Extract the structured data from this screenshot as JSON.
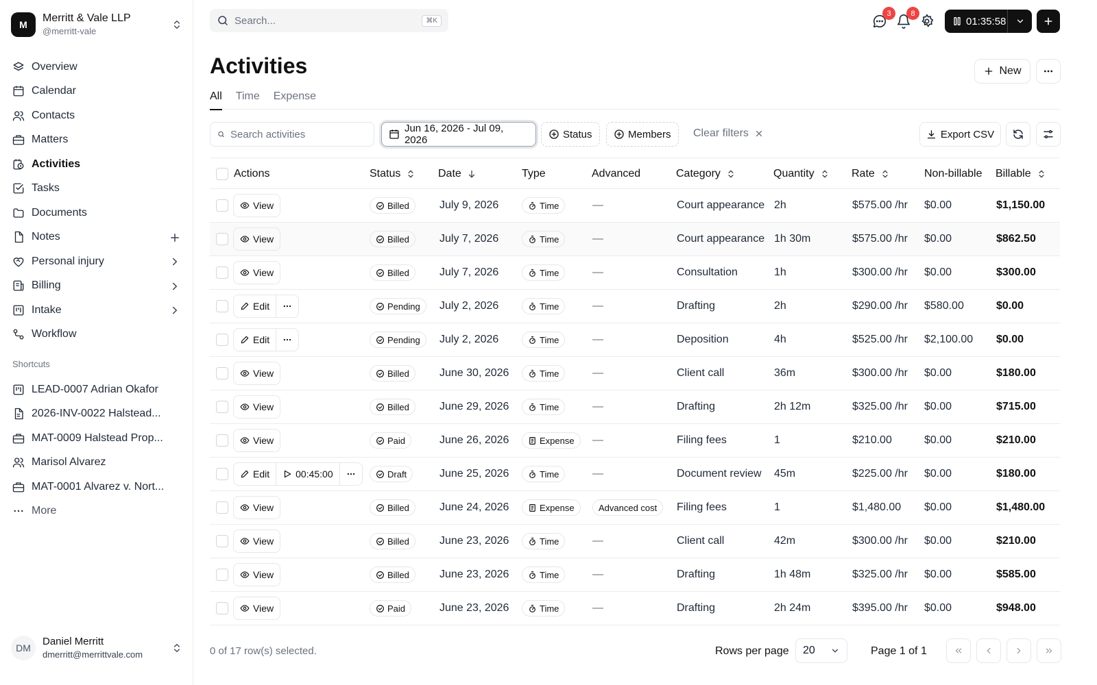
{
  "org": {
    "initial": "M",
    "name": "Merritt & Vale LLP",
    "handle": "@merritt-vale"
  },
  "nav": {
    "overview": "Overview",
    "calendar": "Calendar",
    "contacts": "Contacts",
    "matters": "Matters",
    "activities": "Activities",
    "tasks": "Tasks",
    "documents": "Documents",
    "notes": "Notes",
    "personal_injury": "Personal injury",
    "billing": "Billing",
    "intake": "Intake",
    "workflow": "Workflow"
  },
  "shortcuts": {
    "title": "Shortcuts",
    "items": [
      "LEAD-0007 Adrian Okafor",
      "2026-INV-0022 Halstead...",
      "MAT-0009 Halstead Prop...",
      "Marisol Alvarez",
      "MAT-0001 Alvarez v. Nort..."
    ],
    "more": "More"
  },
  "user": {
    "initials": "DM",
    "name": "Daniel Merritt",
    "email": "dmerritt@merrittvale.com"
  },
  "topbar": {
    "search_placeholder": "Search...",
    "search_shortcut": "⌘K",
    "messages_badge": "3",
    "notifications_badge": "8",
    "timer": "01:35:58"
  },
  "page": {
    "title": "Activities",
    "new_label": "New",
    "tabs": [
      "All",
      "Time",
      "Expense"
    ]
  },
  "filters": {
    "search_placeholder": "Search activities",
    "date_range": "Jun 16, 2026 - Jul 09, 2026",
    "status": "Status",
    "members": "Members",
    "clear": "Clear filters",
    "export": "Export CSV"
  },
  "table": {
    "headers": {
      "actions": "Actions",
      "status": "Status",
      "date": "Date",
      "type": "Type",
      "advanced": "Advanced",
      "category": "Category",
      "quantity": "Quantity",
      "rate": "Rate",
      "nonbillable": "Non-billable",
      "billable": "Billable"
    },
    "rows": [
      {
        "action": "View",
        "status": "Billed",
        "date": "July 9, 2026",
        "type": "Time",
        "advanced": "—",
        "category": "Court appearance",
        "quantity": "2h",
        "rate": "$575.00 /hr",
        "nonbillable": "$0.00",
        "billable": "$1,150.00"
      },
      {
        "action": "View",
        "status": "Billed",
        "date": "July 7, 2026",
        "type": "Time",
        "advanced": "—",
        "category": "Court appearance",
        "quantity": "1h 30m",
        "rate": "$575.00 /hr",
        "nonbillable": "$0.00",
        "billable": "$862.50"
      },
      {
        "action": "View",
        "status": "Billed",
        "date": "July 7, 2026",
        "type": "Time",
        "advanced": "—",
        "category": "Consultation",
        "quantity": "1h",
        "rate": "$300.00 /hr",
        "nonbillable": "$0.00",
        "billable": "$300.00"
      },
      {
        "action": "Edit",
        "status": "Pending",
        "date": "July 2, 2026",
        "type": "Time",
        "advanced": "—",
        "category": "Drafting",
        "quantity": "2h",
        "rate": "$290.00 /hr",
        "nonbillable": "$580.00",
        "billable": "$0.00"
      },
      {
        "action": "Edit",
        "status": "Pending",
        "date": "July 2, 2026",
        "type": "Time",
        "advanced": "—",
        "category": "Deposition",
        "quantity": "4h",
        "rate": "$525.00 /hr",
        "nonbillable": "$2,100.00",
        "billable": "$0.00"
      },
      {
        "action": "View",
        "status": "Billed",
        "date": "June 30, 2026",
        "type": "Time",
        "advanced": "—",
        "category": "Client call",
        "quantity": "36m",
        "rate": "$300.00 /hr",
        "nonbillable": "$0.00",
        "billable": "$180.00"
      },
      {
        "action": "View",
        "status": "Billed",
        "date": "June 29, 2026",
        "type": "Time",
        "advanced": "—",
        "category": "Drafting",
        "quantity": "2h 12m",
        "rate": "$325.00 /hr",
        "nonbillable": "$0.00",
        "billable": "$715.00"
      },
      {
        "action": "View",
        "status": "Paid",
        "date": "June 26, 2026",
        "type": "Expense",
        "advanced": "—",
        "category": "Filing fees",
        "quantity": "1",
        "rate": "$210.00",
        "nonbillable": "$0.00",
        "billable": "$210.00"
      },
      {
        "action": "Edit",
        "timer": "00:45:00",
        "status": "Draft",
        "date": "June 25, 2026",
        "type": "Time",
        "advanced": "—",
        "category": "Document review",
        "quantity": "45m",
        "rate": "$225.00 /hr",
        "nonbillable": "$0.00",
        "billable": "$180.00"
      },
      {
        "action": "View",
        "status": "Billed",
        "date": "June 24, 2026",
        "type": "Expense",
        "advanced": "Advanced cost",
        "category": "Filing fees",
        "quantity": "1",
        "rate": "$1,480.00",
        "nonbillable": "$0.00",
        "billable": "$1,480.00"
      },
      {
        "action": "View",
        "status": "Billed",
        "date": "June 23, 2026",
        "type": "Time",
        "advanced": "—",
        "category": "Client call",
        "quantity": "42m",
        "rate": "$300.00 /hr",
        "nonbillable": "$0.00",
        "billable": "$210.00"
      },
      {
        "action": "View",
        "status": "Billed",
        "date": "June 23, 2026",
        "type": "Time",
        "advanced": "—",
        "category": "Drafting",
        "quantity": "1h 48m",
        "rate": "$325.00 /hr",
        "nonbillable": "$0.00",
        "billable": "$585.00"
      },
      {
        "action": "View",
        "status": "Paid",
        "date": "June 23, 2026",
        "type": "Time",
        "advanced": "—",
        "category": "Drafting",
        "quantity": "2h 24m",
        "rate": "$395.00 /hr",
        "nonbillable": "$0.00",
        "billable": "$948.00"
      }
    ]
  },
  "footer": {
    "selected": "0 of 17 row(s) selected.",
    "rows_per_page_label": "Rows per page",
    "rows_per_page": "20",
    "page": "Page 1 of 1"
  }
}
